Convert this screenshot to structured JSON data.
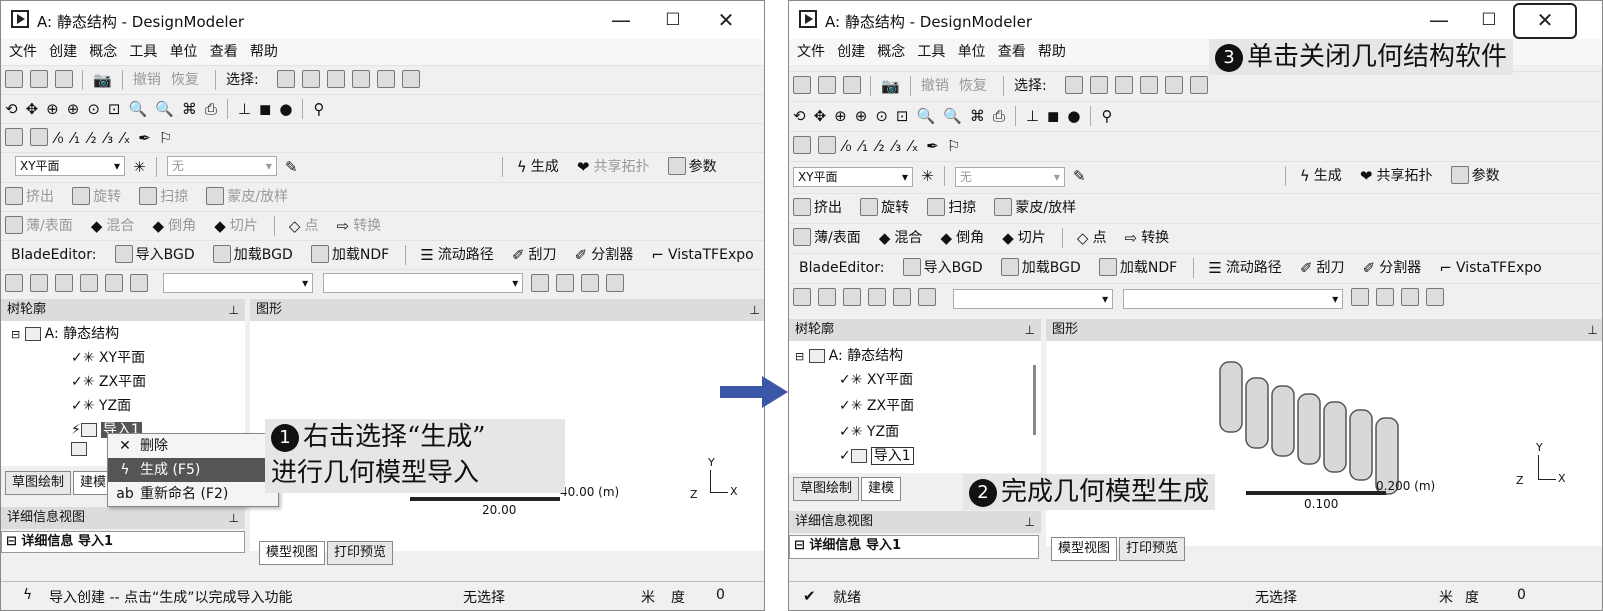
{
  "left": {
    "title": "A: 静态结构 - DesignModeler",
    "menu": [
      "文件",
      "创建",
      "概念",
      "工具",
      "单位",
      "查看",
      "帮助"
    ],
    "undo": "撤销",
    "redo": "恢复",
    "select_label": "选择:",
    "plane_select": "XY平面",
    "none_select": "无",
    "generate": "生成",
    "share_topo": "共享拓扑",
    "params": "参数",
    "ops1": [
      "挤出",
      "旋转",
      "扫掠",
      "蒙皮/放样"
    ],
    "ops2": [
      "薄/表面",
      "混合",
      "倒角",
      "切片",
      "点",
      "转换"
    ],
    "blade_label": "BladeEditor:",
    "blade": [
      "导入BGD",
      "加载BGD",
      "加载NDF",
      "流动路径",
      "刮刀",
      "分割器",
      "VistaTFExpo"
    ],
    "tree_head": "树轮廓",
    "graph_head": "图形",
    "tree": [
      "A: 静态结构",
      "XY平面",
      "ZX平面",
      "YZ面",
      "导入1"
    ],
    "ctx": [
      "删除",
      "生成 (F5)",
      "重新命名 (F2)"
    ],
    "tabs_left": [
      "草图绘制",
      "建模"
    ],
    "detail_head": "详细信息视图",
    "detail_row": "详细信息 导入1",
    "tabs_graph": [
      "模型视图",
      "打印预览"
    ],
    "scale_a": "40.00 (m)",
    "scale_b": "20.00",
    "status": "导入创建 -- 点击“生成”以完成导入功能",
    "status_sel": "无选择",
    "status_unit": "米",
    "status_deg": "度",
    "status_zero": "0",
    "callout1": "右击选择“生成”\n进行几何模型导入"
  },
  "right": {
    "title": "A: 静态结构 - DesignModeler",
    "menu": [
      "文件",
      "创建",
      "概念",
      "工具",
      "单位",
      "查看",
      "帮助"
    ],
    "undo": "撤销",
    "redo": "恢复",
    "select_label": "选择:",
    "plane_select": "XY平面",
    "none_select": "无",
    "generate": "生成",
    "share_topo": "共享拓扑",
    "params": "参数",
    "ops1": [
      "挤出",
      "旋转",
      "扫掠",
      "蒙皮/放样"
    ],
    "ops2": [
      "薄/表面",
      "混合",
      "倒角",
      "切片",
      "点",
      "转换"
    ],
    "blade_label": "BladeEditor:",
    "blade": [
      "导入BGD",
      "加载BGD",
      "加载NDF",
      "流动路径",
      "刮刀",
      "分割器",
      "VistaTFExpo"
    ],
    "tree_head": "树轮廓",
    "graph_head": "图形",
    "tree": [
      "A: 静态结构",
      "XY平面",
      "ZX平面",
      "YZ面",
      "导入1"
    ],
    "tabs_left": [
      "草图绘制",
      "建模"
    ],
    "detail_head": "详细信息视图",
    "detail_row": "详细信息 导入1",
    "tabs_graph": [
      "模型视图",
      "打印预览"
    ],
    "scale_a": "0.200 (m)",
    "scale_b": "0.100",
    "status": "就绪",
    "status_sel": "无选择",
    "status_unit": "米",
    "status_deg": "度",
    "status_zero": "0",
    "callout2": "完成几何模型生成",
    "callout3": "单击关闭几何结构软件"
  },
  "colors": {
    "arrow": "#3b57a6",
    "highlight": "#555555"
  }
}
